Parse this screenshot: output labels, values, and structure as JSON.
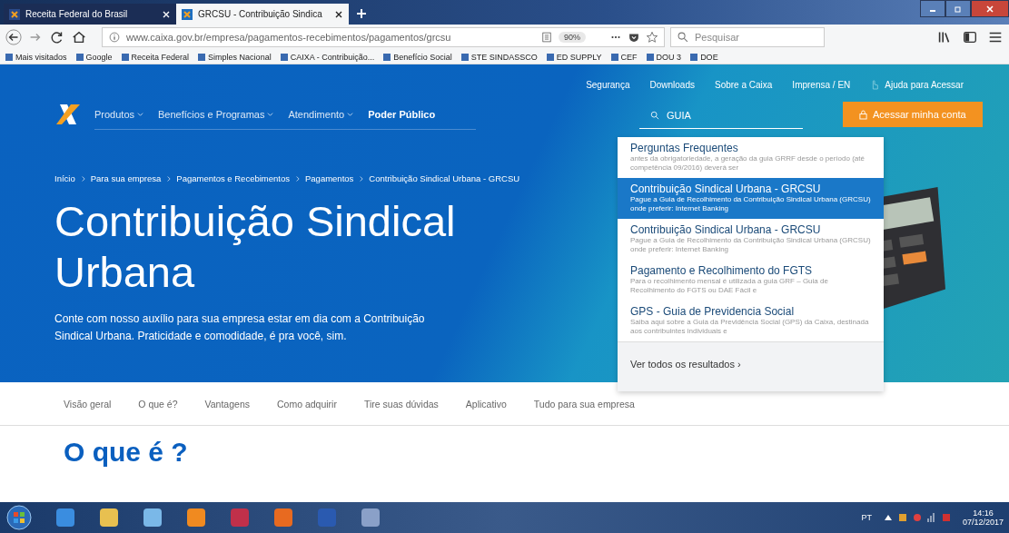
{
  "browser": {
    "tabs": [
      {
        "label": "Receita Federal do Brasil",
        "selected": false
      },
      {
        "label": "GRCSU - Contribuição Sindica",
        "selected": true
      }
    ],
    "url": "www.caixa.gov.br/empresa/pagamentos-recebimentos/pagamentos/grcsu",
    "zoom": "90%",
    "search_placeholder": "Pesquisar",
    "bookmarks": [
      "Mais visitados",
      "Google",
      "Receita Federal",
      "Simples Nacional",
      "CAIXA - Contribuição...",
      "Benefício Social",
      "STE SINDASSCO",
      "ED SUPPLY",
      "CEF",
      "DOU 3",
      "DOE"
    ]
  },
  "site": {
    "top_links": [
      "Segurança",
      "Downloads",
      "Sobre a Caixa",
      "Imprensa / EN",
      "Ajuda para Acessar"
    ],
    "nav": [
      {
        "label": "Produtos",
        "dropdown": true
      },
      {
        "label": "Benefícios e Programas",
        "dropdown": true
      },
      {
        "label": "Atendimento",
        "dropdown": true
      },
      {
        "label": "Poder Público",
        "dropdown": false
      }
    ],
    "search_value": "GUIA",
    "account_button": "Acessar minha conta",
    "breadcrumb": [
      "Início",
      "Para sua empresa",
      "Pagamentos e Recebimentos",
      "Pagamentos",
      "Contribuição Sindical Urbana - GRCSU"
    ],
    "title": "Contribuição Sindical Urbana",
    "description": "Conte com nosso auxílio para sua empresa estar em dia com a Contribuição Sindical Urbana. Praticidade e comodidade, é pra você, sim.",
    "results": [
      {
        "title": "Perguntas Frequentes",
        "text": "antes da obrigatoriedade, a geração da guia GRRF desde o período (até competência 09/2016) deverá ser",
        "selected": false
      },
      {
        "title": "Contribuição Sindical Urbana - GRCSU",
        "text": "Pague a Guia de Recolhimento da Contribuição Sindical Urbana (GRCSU) onde preferir: Internet Banking",
        "selected": true
      },
      {
        "title": "Contribuição Sindical Urbana - GRCSU",
        "text": "Pague a Guia de Recolhimento da Contribuição Sindical Urbana (GRCSU) onde preferir: Internet Banking",
        "selected": false
      },
      {
        "title": "Pagamento e Recolhimento do FGTS",
        "text": "Para o recolhimento mensal é utilizada a guia GRF – Guia de Recolhimento do FGTS ou DAE Fácil e",
        "selected": false
      },
      {
        "title": "GPS - Guia de Previdencia Social",
        "text": "Saiba aqui sobre a Guia da Previdência Social (GPS) da Caixa, destinada aos contribuintes individuais e",
        "selected": false
      }
    ],
    "all_results": "Ver todos os resultados ›",
    "subnav": [
      "Visão geral",
      "O que é?",
      "Vantagens",
      "Como adquirir",
      "Tire suas dúvidas",
      "Aplicativo",
      "Tudo para sua empresa"
    ],
    "section_title": "O que é ?"
  },
  "taskbar": {
    "language": "PT",
    "time": "14:16",
    "date": "07/12/2017"
  }
}
